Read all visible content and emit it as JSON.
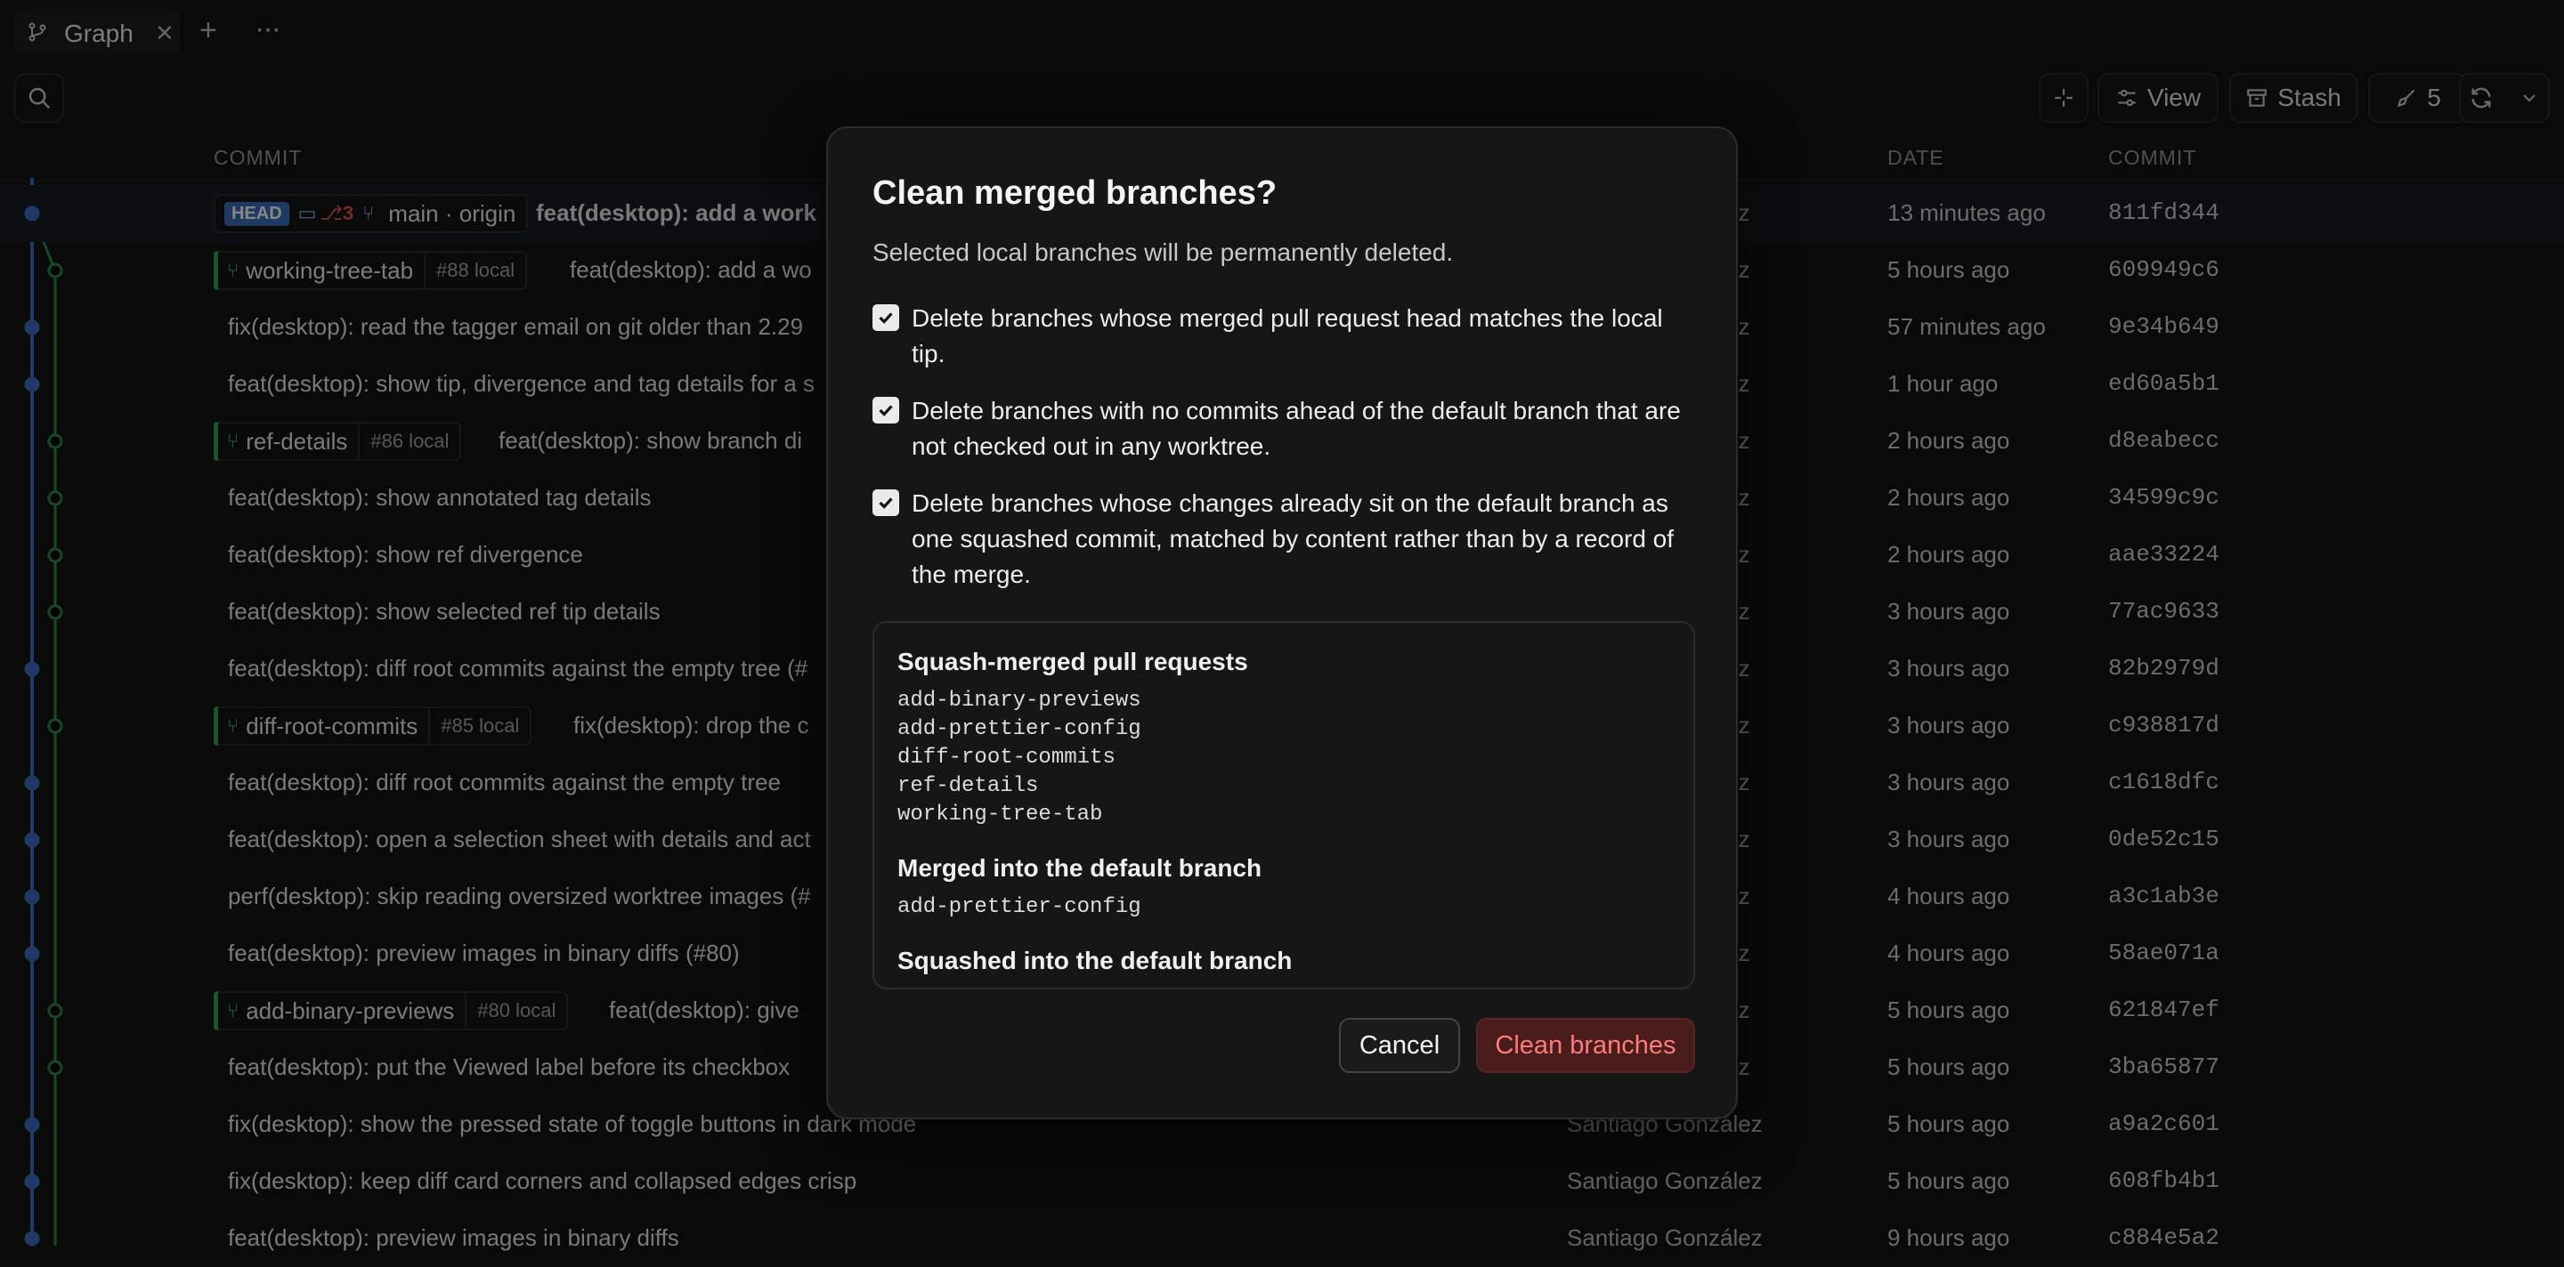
{
  "tabbar": {
    "tab_label": "Graph",
    "close": "✕",
    "add": "+",
    "more": "···"
  },
  "toolbar": {
    "view_label": "View",
    "stash_label": "Stash",
    "pr_count": "5"
  },
  "table": {
    "headers": {
      "commit": "COMMIT",
      "date": "DATE",
      "hash": "COMMIT"
    },
    "rows": [
      {
        "message": "feat(desktop): add a work",
        "author": "ez",
        "date": "13 minutes ago",
        "hash": "811fd344"
      },
      {
        "ref": "working-tree-tab",
        "pr": "#88 local",
        "message": "feat(desktop): add a wo",
        "author": "ez",
        "date": "5 hours ago",
        "hash": "609949c6"
      },
      {
        "message": "fix(desktop): read the tagger email on git older than 2.29",
        "author": "ez",
        "date": "57 minutes ago",
        "hash": "9e34b649"
      },
      {
        "message": "feat(desktop): show tip, divergence and tag details for a s",
        "author": "ez",
        "date": "1 hour ago",
        "hash": "ed60a5b1"
      },
      {
        "ref": "ref-details",
        "pr": "#86 local",
        "message": "feat(desktop): show branch di",
        "author": "ez",
        "date": "2 hours ago",
        "hash": "d8eabecc"
      },
      {
        "message": "feat(desktop): show annotated tag details",
        "author": "ez",
        "date": "2 hours ago",
        "hash": "34599c9c"
      },
      {
        "message": "feat(desktop): show ref divergence",
        "author": "ez",
        "date": "2 hours ago",
        "hash": "aae33224"
      },
      {
        "message": "feat(desktop): show selected ref tip details",
        "author": "ez",
        "date": "3 hours ago",
        "hash": "77ac9633"
      },
      {
        "message": "feat(desktop): diff root commits against the empty tree (#",
        "author": "ez",
        "date": "3 hours ago",
        "hash": "82b2979d"
      },
      {
        "ref": "diff-root-commits",
        "pr": "#85 local",
        "message": "fix(desktop): drop the c",
        "author": "ez",
        "date": "3 hours ago",
        "hash": "c938817d"
      },
      {
        "message": "feat(desktop): diff root commits against the empty tree",
        "author": "ez",
        "date": "3 hours ago",
        "hash": "c1618dfc"
      },
      {
        "message": "feat(desktop): open a selection sheet with details and act",
        "author": "ez",
        "date": "3 hours ago",
        "hash": "0de52c15"
      },
      {
        "message": "perf(desktop): skip reading oversized worktree images (#",
        "author": "ez",
        "date": "4 hours ago",
        "hash": "a3c1ab3e"
      },
      {
        "message": "feat(desktop): preview images in binary diffs (#80)",
        "author": "ez",
        "date": "4 hours ago",
        "hash": "58ae071a"
      },
      {
        "ref": "add-binary-previews",
        "pr": "#80 local",
        "message": "feat(desktop): give",
        "author": "ez",
        "date": "5 hours ago",
        "hash": "621847ef"
      },
      {
        "message": "feat(desktop): put the Viewed label before its checkbox",
        "author": "ez",
        "date": "5 hours ago",
        "hash": "3ba65877"
      },
      {
        "message": "fix(desktop): show the pressed state of toggle buttons in dark mode",
        "author": "Santiago González",
        "date": "5 hours ago",
        "hash": "a9a2c601"
      },
      {
        "message": "fix(desktop): keep diff card corners and collapsed edges crisp",
        "author": "Santiago González",
        "date": "5 hours ago",
        "hash": "608fb4b1"
      },
      {
        "message": "feat(desktop): preview images in binary diffs",
        "author": "Santiago González",
        "date": "9 hours ago",
        "hash": "c884e5a2"
      }
    ],
    "head_row": {
      "badge": "HEAD",
      "count": "3",
      "ref": "main · origin"
    }
  },
  "dialog": {
    "title": "Clean merged branches?",
    "description": "Selected local branches will be permanently deleted.",
    "options": [
      "Delete branches whose merged pull request head matches the local tip.",
      "Delete branches with no commits ahead of the default branch that are not checked out in any worktree.",
      "Delete branches whose changes already sit on the default branch as one squashed commit, matched by content rather than by a record of the merge."
    ],
    "sections": {
      "squash_prs_title": "Squash-merged pull requests",
      "squash_prs": [
        "add-binary-previews",
        "add-prettier-config",
        "diff-root-commits",
        "ref-details",
        "working-tree-tab"
      ],
      "merged_title": "Merged into the default branch",
      "merged": [
        "add-prettier-config"
      ],
      "squashed_title": "Squashed into the default branch"
    },
    "cancel_label": "Cancel",
    "confirm_label": "Clean branches"
  }
}
